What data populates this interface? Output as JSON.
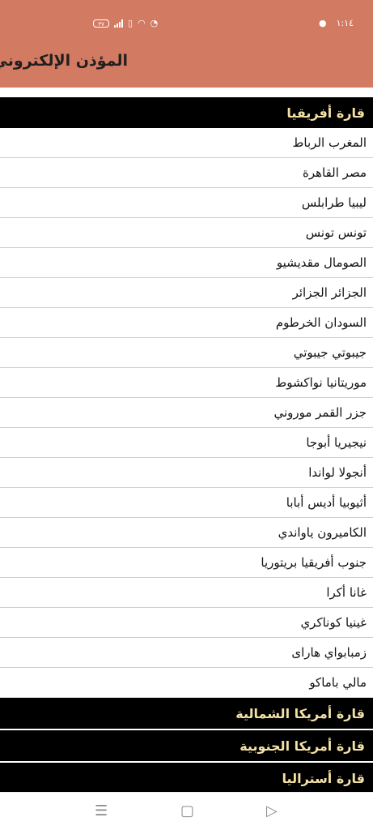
{
  "status_bar": {
    "time": "١:١٤",
    "battery": "٣٧"
  },
  "app_bar": {
    "title": "المؤذن الإلكتروني",
    "color": "#d37a62"
  },
  "sections": [
    {
      "title": "قارة أفريقيا",
      "rows": [
        "المغرب الرباط",
        "مصر القاهرة",
        "ليبيا طرابلس",
        "تونس تونس",
        "الصومال مقديشيو",
        "الجزائر الجزائر",
        "السودان الخرطوم",
        "جيبوتي جيبوتي",
        "موريتانيا نواكشوط",
        "جزر القمر موروني",
        "نيجيريا أبوجا",
        "أنجولا لواندا",
        "أثيوبيا أديس أبابا",
        "الكاميرون ياواندي",
        "جنوب أفريقيا بريتوريا",
        "غانا أكرا",
        "غينيا كوناكري",
        "زمبابواي هاراى",
        "مالي باماكو"
      ]
    },
    {
      "title": "قارة أمريكا الشمالية",
      "rows": []
    },
    {
      "title": "قارة أمريكا الجنوبية",
      "rows": []
    },
    {
      "title": "قارة أستراليا",
      "rows": []
    }
  ],
  "nav_icons": [
    "menu-icon",
    "home-square-icon",
    "back-triangle-icon"
  ]
}
